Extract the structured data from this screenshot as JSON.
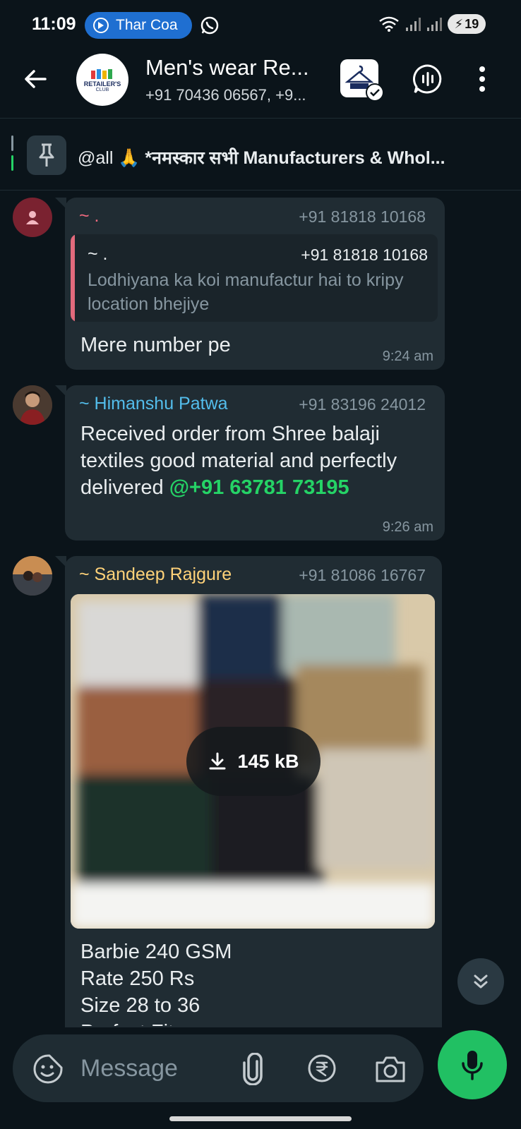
{
  "status_bar": {
    "time": "11:09",
    "live_pill": "Thar Coa",
    "battery": "19"
  },
  "header": {
    "group_name": "Men's wear Re...",
    "members": "+91 70436 06567, +9...",
    "avatar_logo": "RETAILER'S",
    "avatar_logo_sub": "CLUB"
  },
  "pinned": {
    "text": "@all 🙏 ",
    "bold_text": "*नमस्कार सभी Manufacturers & Whol..."
  },
  "messages": [
    {
      "sender": "~ .",
      "phone": "+91 81818 10168",
      "quote": {
        "sender": "~ .",
        "phone": "+91 81818 10168",
        "text": "Lodhiyana ka koi manufactur hai to kripy location bhejiye"
      },
      "text": "Mere number pe",
      "time": "9:24 am"
    },
    {
      "sender": "~ Himanshu Patwa",
      "phone": "+91 83196 24012",
      "text": "Received order from Shree balaji textiles good material and perfectly delivered ",
      "mention": "@+91 63781 73195",
      "time": "9:26 am"
    },
    {
      "sender": "~ Sandeep Rajgure",
      "phone": "+91 81086 16767",
      "media_size": "145 kB",
      "lines": [
        "Barbie 240 GSM",
        "Rate 250 Rs",
        "Size 28 to 36",
        "Perfect Fit"
      ]
    }
  ],
  "composer": {
    "placeholder": "Message"
  },
  "colors": {
    "background": "#0b141a",
    "bubble": "#202c33",
    "accent": "#25d366",
    "sender1": "#f06a7f",
    "sender2": "#53bdeb",
    "sender3": "#ffd279"
  }
}
